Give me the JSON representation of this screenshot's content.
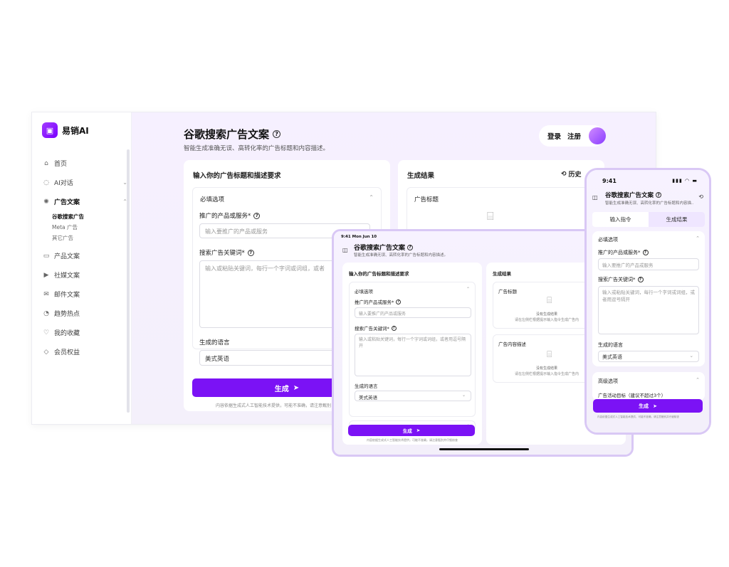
{
  "brand": {
    "logo_text": "易销AI"
  },
  "sidebar": {
    "items": [
      {
        "label": "首页",
        "icon": "home-icon",
        "glyph": "⌂"
      },
      {
        "label": "AI对话",
        "icon": "chat-icon",
        "glyph": "◌",
        "chevron": "⌄"
      },
      {
        "label": "广告文案",
        "icon": "ad-icon",
        "glyph": "✺",
        "chevron": "⌃"
      },
      {
        "label": "产品文案",
        "icon": "product-icon",
        "glyph": "▭"
      },
      {
        "label": "社媒文案",
        "icon": "social-icon",
        "glyph": "▶"
      },
      {
        "label": "邮件文案",
        "icon": "mail-icon",
        "glyph": "✉"
      },
      {
        "label": "趋势热点",
        "icon": "trend-icon",
        "glyph": "◔"
      },
      {
        "label": "我的收藏",
        "icon": "favorite-icon",
        "glyph": "♡"
      },
      {
        "label": "会员权益",
        "icon": "member-icon",
        "glyph": "◇"
      }
    ],
    "sub_items": [
      "谷歌搜索广告",
      "Meta 广告",
      "其它广告"
    ]
  },
  "header": {
    "title": "谷歌搜索广告文案",
    "subtitle": "智能生成准确无误、高转化率的广告标题和内容描述。",
    "login": "登录",
    "register": "注册"
  },
  "form": {
    "heading": "输入你的广告标题和描述要求",
    "required_section": "必填选项",
    "product_label": "推广的产品或服务*",
    "product_placeholder": "输入要推广的产品或服务",
    "keywords_label": "搜索广告关键词*",
    "keywords_placeholder": "输入或粘贴关键词，每行一个字词或词组，或者",
    "keywords_placeholder_full": "输入或粘贴关键词，每行一个字词或词组，或者用逗号隔开",
    "language_label": "生成的语言",
    "language_value": "美式英语",
    "advanced_section": "高级选项",
    "generate_label": "生成",
    "disclaimer": "内容依据生成式人工智能技术提供，可能不准确，请注意甄别",
    "disclaimer_short": "内容依据生成式人工智能技术提供，可能不准确，请注意甄别并",
    "disclaimer_tablet": "内容依据生成式人工智能技术提供，可能不准确，请注意甄别并仔细核查",
    "disclaimer_phone": "内容依据生成式人工智能技术提供，可能不准确，请注意甄别并仔细核查",
    "ad_goal_label": "广告活动目标（建议不超过3个）"
  },
  "result": {
    "heading": "生成结果",
    "history": "历史",
    "ad_title": "广告标题",
    "ad_desc": "广告内容描述",
    "empty_title": "没有生成结果",
    "empty_hint": "请在左侧栏根据提示输入指令生成广告内",
    "empty_hint_phone": "请在左侧栏根据提示输入指令生成广告内"
  },
  "tablet": {
    "status_time": "9:41  Mon Jun 10"
  },
  "phone": {
    "status_time": "9:41",
    "status_icons": "▮▮▮ ◠ ▬",
    "tab_input": "输入指令",
    "tab_result": "生成结果",
    "subtitle": "智能生成准确无误、高转化率的广告标题和内容描..."
  },
  "colors": {
    "accent": "#7b12f5",
    "page_bg": "#f5f0fc"
  }
}
